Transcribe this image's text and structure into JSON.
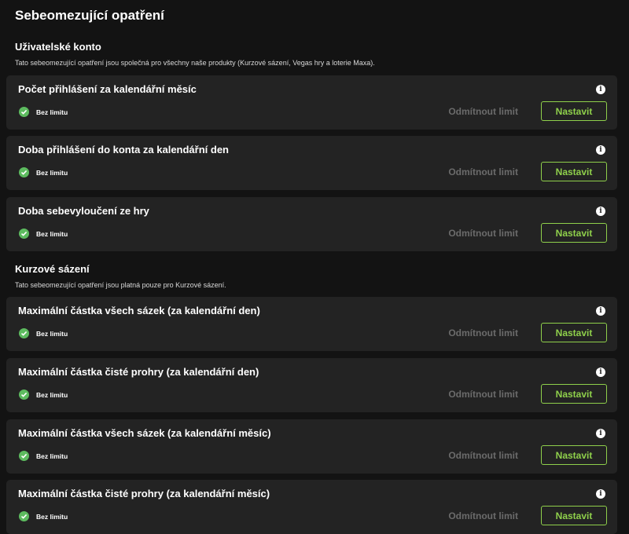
{
  "page_title": "Sebeomezující opatření",
  "sections": [
    {
      "title": "Uživatelské konto",
      "description": "Tato sebeomezující opatření jsou společná pro všechny naše produkty (Kurzové sázení, Vegas hry a loterie Maxa).",
      "cards": [
        {
          "title": "Počet přihlášení za kalendářní měsíc",
          "status": "Bez limitu",
          "decline": "Odmítnout limit",
          "button": "Nastavit"
        },
        {
          "title": "Doba přihlášení do konta za kalendářní den",
          "status": "Bez limitu",
          "decline": "Odmítnout limit",
          "button": "Nastavit"
        },
        {
          "title": "Doba sebevyloučení ze hry",
          "status": "Bez limitu",
          "decline": "Odmítnout limit",
          "button": "Nastavit"
        }
      ]
    },
    {
      "title": "Kurzové sázení",
      "description": "Tato sebeomezující opatření jsou platná pouze pro Kurzové sázení.",
      "cards": [
        {
          "title": "Maximální částka všech sázek (za kalendářní den)",
          "status": "Bez limitu",
          "decline": "Odmítnout limit",
          "button": "Nastavit"
        },
        {
          "title": "Maximální částka čisté prohry (za kalendářní den)",
          "status": "Bez limitu",
          "decline": "Odmítnout limit",
          "button": "Nastavit"
        },
        {
          "title": "Maximální částka všech sázek (za kalendářní měsíc)",
          "status": "Bez limitu",
          "decline": "Odmítnout limit",
          "button": "Nastavit"
        },
        {
          "title": "Maximální částka čisté prohry (za kalendářní měsíc)",
          "status": "Bez limitu",
          "decline": "Odmítnout limit",
          "button": "Nastavit"
        }
      ]
    }
  ],
  "icons": {
    "info": "info-icon",
    "status": "check-circle-icon"
  },
  "colors": {
    "background": "#131313",
    "card": "#232323",
    "accent": "#8fd04b",
    "success": "#5dbb5f",
    "muted": "#6b6b6b"
  }
}
